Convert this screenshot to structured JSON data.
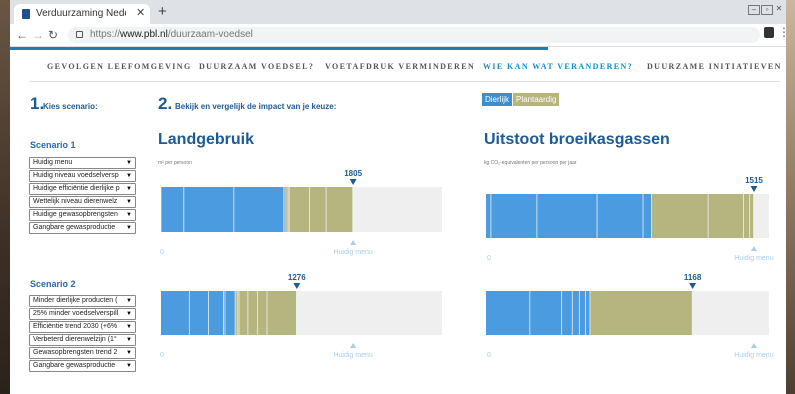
{
  "browser": {
    "tab_title": "Verduurzaming Nederlands voed",
    "url_scheme": "https://",
    "url_host": "www.pbl.nl",
    "url_path": "/duurzaam-voedsel"
  },
  "nav": {
    "items": [
      "GEVOLGEN LEEFOMGEVING",
      "DUURZAAM VOEDSEL?",
      "VOETAFDRUK VERMINDEREN",
      "WIE KAN WAT VERANDEREN?",
      "DUURZAME INITIATIEVEN"
    ],
    "active_index": 3
  },
  "steps": {
    "step1_num": "1.",
    "step1_label": "Kies scenario:",
    "step2_num": "2.",
    "step2_label": "Bekijk en vergelijk de impact van je keuze:"
  },
  "legend": {
    "animal": "Dierlijk",
    "plant": "Plantaardig"
  },
  "scenarios": [
    {
      "title": "Scenario 1",
      "selects": [
        "Huidig menu",
        "Huidig niveau voedselversp",
        "Huidige efficiëntie dierlijke p",
        "Wettelijk niveau dierenwelz",
        "Huidige gewasopbrengsten",
        "Gangbare gewasproductie"
      ]
    },
    {
      "title": "Scenario 2",
      "selects": [
        "Minder dierlijke producten (",
        "25% minder voedselverspill",
        "Efficiëntie trend 2030 (+6%",
        "Verbeterd dierenwelzijn (1°",
        "Gewasopbrengsten trend 2",
        "Gangbare gewasproductie"
      ]
    }
  ],
  "charts": {
    "landuse": {
      "title": "Landgebruik",
      "unit": "m² per persoon"
    },
    "emissions": {
      "title": "Uitstoot broeikasgassen",
      "unit": "kg CO₂-equivalenten per persoon per jaar"
    }
  },
  "colors": {
    "animal": "#4b9be0",
    "plant": "#b5b57f",
    "track": "#efefef",
    "marker": "#1d5b94",
    "reference": "#a9cde9",
    "nav_active": "#1b8ac4"
  },
  "chart_data": [
    {
      "type": "bar",
      "title": "Landgebruik",
      "ylabel": "m² per persoon",
      "axis_zero_label": "0",
      "reference_label": "Huidig menu",
      "xlim": [
        0,
        2640
      ],
      "series_names": [
        "Dierlijk",
        "Plantaardig"
      ],
      "bars": [
        {
          "scenario": "Scenario 1",
          "total": 1805,
          "animal": 1175,
          "plant": 630,
          "animal_seg": [
            8,
            210,
            470,
            470,
            8,
            9
          ],
          "plant_seg": [
            6,
            8,
            10,
            10,
            190,
            156,
            250
          ]
        },
        {
          "scenario": "Scenario 2",
          "total": 1276,
          "animal": 700,
          "plant": 576,
          "animal_seg": [
            270,
            180,
            140,
            8,
            8,
            94
          ],
          "plant_seg": [
            6,
            20,
            10,
            4,
            80,
            90,
            90,
            276
          ]
        }
      ],
      "reference_value": 1805
    },
    {
      "type": "bar",
      "title": "Uitstoot broeikasgassen",
      "ylabel": "kg CO₂-equivalenten per persoon per jaar",
      "axis_zero_label": "0",
      "reference_label": "Huidig menu",
      "xlim": [
        0,
        1600
      ],
      "series_names": [
        "Dierlijk",
        "Plantaardig"
      ],
      "bars": [
        {
          "scenario": "Scenario 1",
          "total": 1515,
          "animal": 938,
          "plant": 577,
          "animal_seg": [
            30,
            260,
            340,
            260,
            48
          ],
          "plant_seg": [
            320,
            200,
            35,
            22
          ]
        },
        {
          "scenario": "Scenario 2",
          "total": 1168,
          "animal": 590,
          "plant": 578,
          "animal_seg": [
            250,
            180,
            60,
            40,
            35,
            25
          ],
          "plant_seg": [
            578
          ]
        }
      ],
      "reference_value": 1515
    }
  ]
}
